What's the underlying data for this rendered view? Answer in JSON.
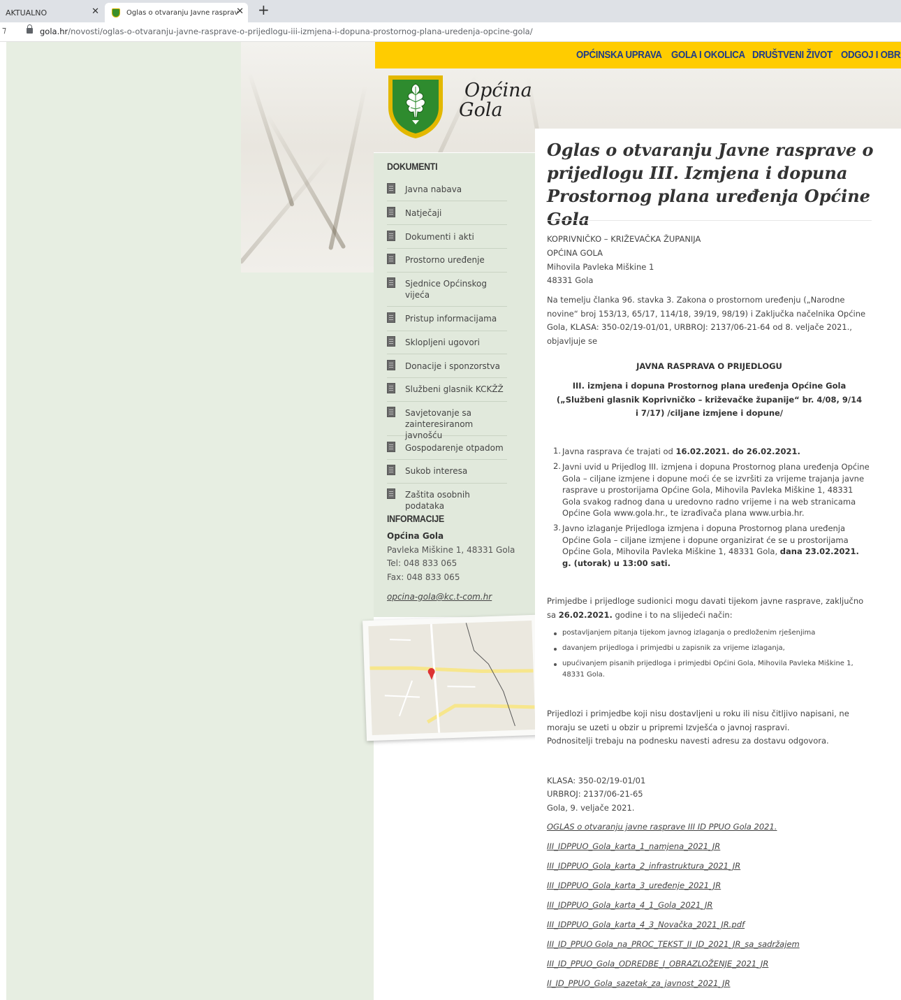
{
  "browser": {
    "tabs": [
      {
        "label": "AKTUALNO"
      },
      {
        "label": "Oglas o otvaranju Javne rasprave"
      }
    ],
    "url_domain": "gola.hr",
    "url_path": "/novosti/oglas-o-otvaranju-javne-rasprave-o-prijedlogu-iii-izmjena-i-dopuna-prostornog-plana-uredenja-opcine-gola/"
  },
  "nav": {
    "items": [
      "OPĆINSKA UPRAVA",
      "GOLA I OKOLICA",
      "DRUŠTVENI ŽIVOT",
      "ODGOJ I OBRA"
    ]
  },
  "logo": {
    "line1": "Općina",
    "line2": "Gola"
  },
  "sidebar": {
    "documents_heading": "DOKUMENTI",
    "items": [
      "Javna nabava",
      "Natječaji",
      "Dokumenti i akti",
      "Prostorno uređenje",
      "Sjednice Općinskog vijeća",
      "Pristup informacijama",
      "Sklopljeni ugovori",
      "Donacije i sponzorstva",
      "Službeni glasnik KCKŽŽ",
      "Savjetovanje sa zainteresiranom javnošću",
      "Gospodarenje otpadom",
      "Sukob interesa",
      "Zaštita osobnih podataka"
    ],
    "info_heading": "INFORMACIJE",
    "info_name": "Općina Gola",
    "info_address": "Pavleka Miškine 1, 48331 Gola",
    "info_tel": "Tel: 048 833 065",
    "info_fax": "Fax: 048 833 065",
    "info_email": "opcina-gola@kc.t-com.hr"
  },
  "article": {
    "title": "Oglas o otvaranju Javne rasprave o prijedlogu III. Izmjena i dopuna Prostornog plana uređenja Općine Gola",
    "header_lines": [
      "KOPRIVNIČKO – KRIŽEVAČKA ŽUPANIJA",
      "OPĆINA GOLA",
      "Mihovila Pavleka Miškine 1",
      "48331 Gola"
    ],
    "intro": "Na temelju članka 96. stavka 3. Zakona o prostornom uređenju („Narodne novine“ broj 153/13, 65/17, 114/18, 39/19, 98/19) i Zaključka načelnika Općine Gola, KLASA: 350-02/19-01/01, URBROJ: 2137/06-21-64 od 8. veljače 2021., objavljuje se",
    "heading1": "JAVNA RASPRAVA O PRIJEDLOGU",
    "heading2": "III. izmjena i dopuna Prostornog plana uređenja Općine Gola („Službeni glasnik Koprivničko – križevačke županije“ br. 4/08, 9/14 i 7/17) /ciljane izmjene i dopune/",
    "item1_prefix": "Javna rasprava će trajati od ",
    "item1_bold": "16.02.2021. do 26.02.2021.",
    "item2": "Javni uvid u Prijedlog III. izmjena i dopuna Prostornog plana uređenja Općine Gola – ciljane izmjene i dopune moći će se izvršiti za vrijeme trajanja javne rasprave u prostorijama Općine Gola, Mihovila Pavleka Miškine 1, 48331 Gola svakog radnog dana u uredovno radno vrijeme i na web stranicama Općine Gola www.gola.hr., te izrađivača plana www.urbia.hr.",
    "item3_prefix": "Javno izlaganje Prijedloga izmjena i dopuna Prostornog plana uređenja Općine Gola – ciljane izmjene i dopune organizirat će se u prostorijama Općine Gola, Mihovila Pavleka Miškine 1, 48331 Gola, ",
    "item3_bold": "dana 23.02.2021. g. (utorak) u 13:00 sati.",
    "remarks_prefix": "Primjedbe i prijedloge sudionici mogu davati tijekom javne rasprave, zaključno sa ",
    "remarks_bold": "26.02.2021.",
    "remarks_suffix": " godine i to na slijedeći način:",
    "bullets": [
      "postavljanjem pitanja tijekom javnog izlaganja o predloženim rješenjima",
      "davanjem prijedloga i primjedbi u zapisnik za vrijeme izlaganja,",
      "upućivanjem pisanih prijedloga i primjedbi Općini Gola, Mihovila Pavleka Miškine 1, 48331 Gola."
    ],
    "note1": "Prijedlozi i primjedbe koji nisu dostavljeni u roku ili nisu čitljivo napisani, ne moraju se uzeti u obzir u pripremi Izvješća o javnoj raspravi.",
    "note2": "Podnositelji trebaju na podnesku navesti adresu za dostavu odgovora.",
    "klasa": "KLASA: 350-02/19-01/01",
    "urbroj": "URBROJ: 2137/06-21-65",
    "place_date": "Gola, 9. veljače 2021.",
    "links": [
      "OGLAS o otvaranju javne rasprave III ID PPUO Gola 2021.",
      "III_IDPPUO_Gola_karta_1_namjena_2021_JR",
      "III_IDPPUO_Gola_karta_2_infrastruktura_2021_JR",
      "III_IDPPUO_Gola_karta_3_uređenje_2021_JR",
      "III_IDPPUO_Gola_karta_4_1_Gola_2021_JR",
      "III_IDPPUO_Gola_karta_4_3_Novačka_2021_JR.pdf",
      "III_ID_PPUO Gola_na_PROC_TEKST_II_ID_2021_JR_sa_sadržajem",
      "III_ID_PPUO_Gola_ODREDBE_I_OBRAZLOŽENJE_2021_JR",
      "II_ID_PPUO_Gola_sazetak_za_javnost_2021_JR"
    ]
  },
  "colors": {
    "nav_bg": "#ffcc00",
    "nav_text": "#1e3b8a",
    "sidebar_bg": "#e1e9dc",
    "crest_green": "#2e8b2e",
    "crest_border": "#e3b800"
  }
}
